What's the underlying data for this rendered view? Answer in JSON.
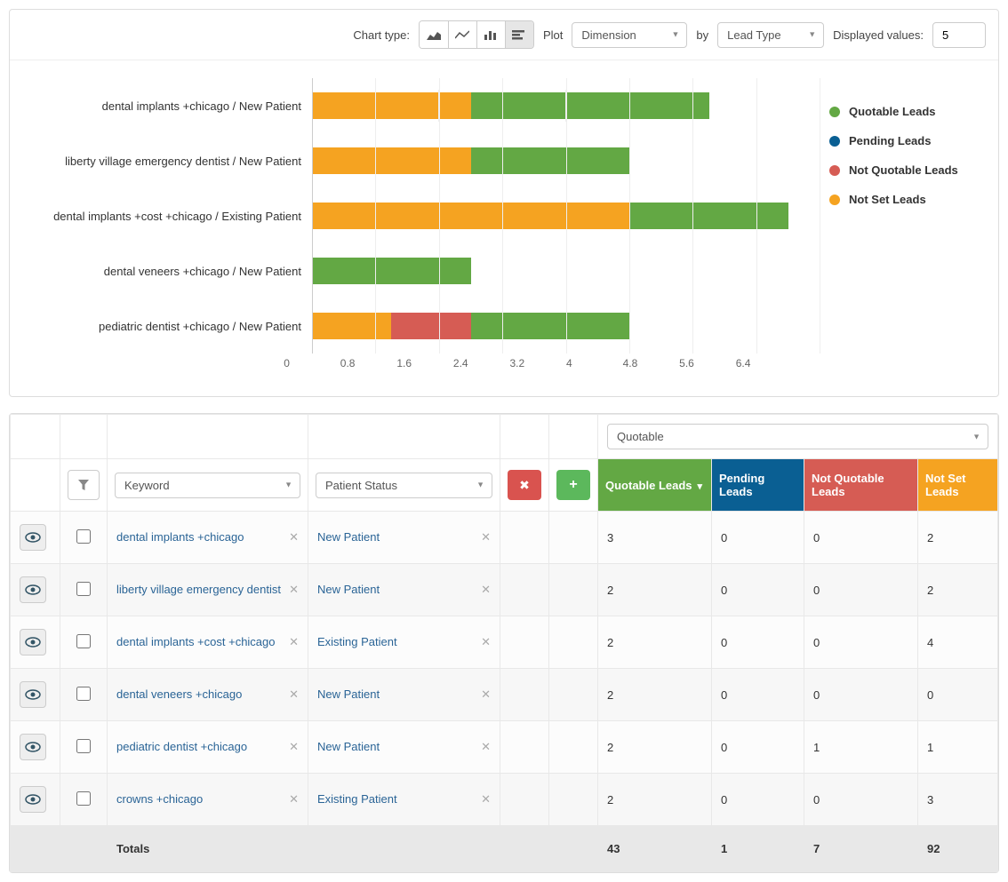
{
  "toolbar": {
    "charttype_label": "Chart type:",
    "plot_label": "Plot",
    "plot_value": "Dimension",
    "by_label": "by",
    "by_value": "Lead Type",
    "displayed_label": "Displayed values:",
    "displayed_value": "5"
  },
  "legend": {
    "quotable": "Quotable Leads",
    "pending": "Pending Leads",
    "notquotable": "Not Quotable Leads",
    "notset": "Not Set Leads"
  },
  "x_ticks": [
    "0",
    "0.8",
    "1.6",
    "2.4",
    "3.2",
    "4",
    "4.8",
    "5.6",
    "6.4"
  ],
  "chart_data": {
    "type": "bar",
    "orientation": "horizontal",
    "stacked": true,
    "x_range": [
      0,
      6.4
    ],
    "categories": [
      "dental implants +chicago / New Patient",
      "liberty village emergency dentist / New Patient",
      "dental implants +cost +chicago / Existing Patient",
      "dental veneers +chicago / New Patient",
      "pediatric dentist +chicago / New Patient"
    ],
    "series": [
      {
        "name": "Not Set Leads",
        "color": "#f5a321",
        "values": [
          2,
          2,
          4,
          0,
          1
        ]
      },
      {
        "name": "Not Quotable Leads",
        "color": "#d65c54",
        "values": [
          0,
          0,
          0,
          0,
          1
        ]
      },
      {
        "name": "Pending Leads",
        "color": "#0a5f93",
        "values": [
          0,
          0,
          0,
          0,
          0
        ]
      },
      {
        "name": "Quotable Leads",
        "color": "#63a844",
        "values": [
          3,
          2,
          2,
          2,
          2
        ]
      }
    ]
  },
  "table": {
    "dim1_label": "Keyword",
    "dim2_label": "Patient Status",
    "metric_select": "Quotable",
    "headers": {
      "m1": "Quotable Leads",
      "m2": "Pending Leads",
      "m3": "Not Quotable Leads",
      "m4": "Not Set Leads"
    },
    "rows": [
      {
        "keyword": "dental implants +chicago",
        "status": "New Patient",
        "m1": "3",
        "m2": "0",
        "m3": "0",
        "m4": "2"
      },
      {
        "keyword": "liberty village emergency dentist",
        "status": "New Patient",
        "m1": "2",
        "m2": "0",
        "m3": "0",
        "m4": "2"
      },
      {
        "keyword": "dental implants +cost +chicago",
        "status": "Existing Patient",
        "m1": "2",
        "m2": "0",
        "m3": "0",
        "m4": "4"
      },
      {
        "keyword": "dental veneers +chicago",
        "status": "New Patient",
        "m1": "2",
        "m2": "0",
        "m3": "0",
        "m4": "0"
      },
      {
        "keyword": "pediatric dentist +chicago",
        "status": "New Patient",
        "m1": "2",
        "m2": "0",
        "m3": "1",
        "m4": "1"
      },
      {
        "keyword": "crowns +chicago",
        "status": "Existing Patient",
        "m1": "2",
        "m2": "0",
        "m3": "0",
        "m4": "3"
      }
    ],
    "totals_label": "Totals",
    "totals": {
      "m1": "43",
      "m2": "1",
      "m3": "7",
      "m4": "92"
    }
  }
}
